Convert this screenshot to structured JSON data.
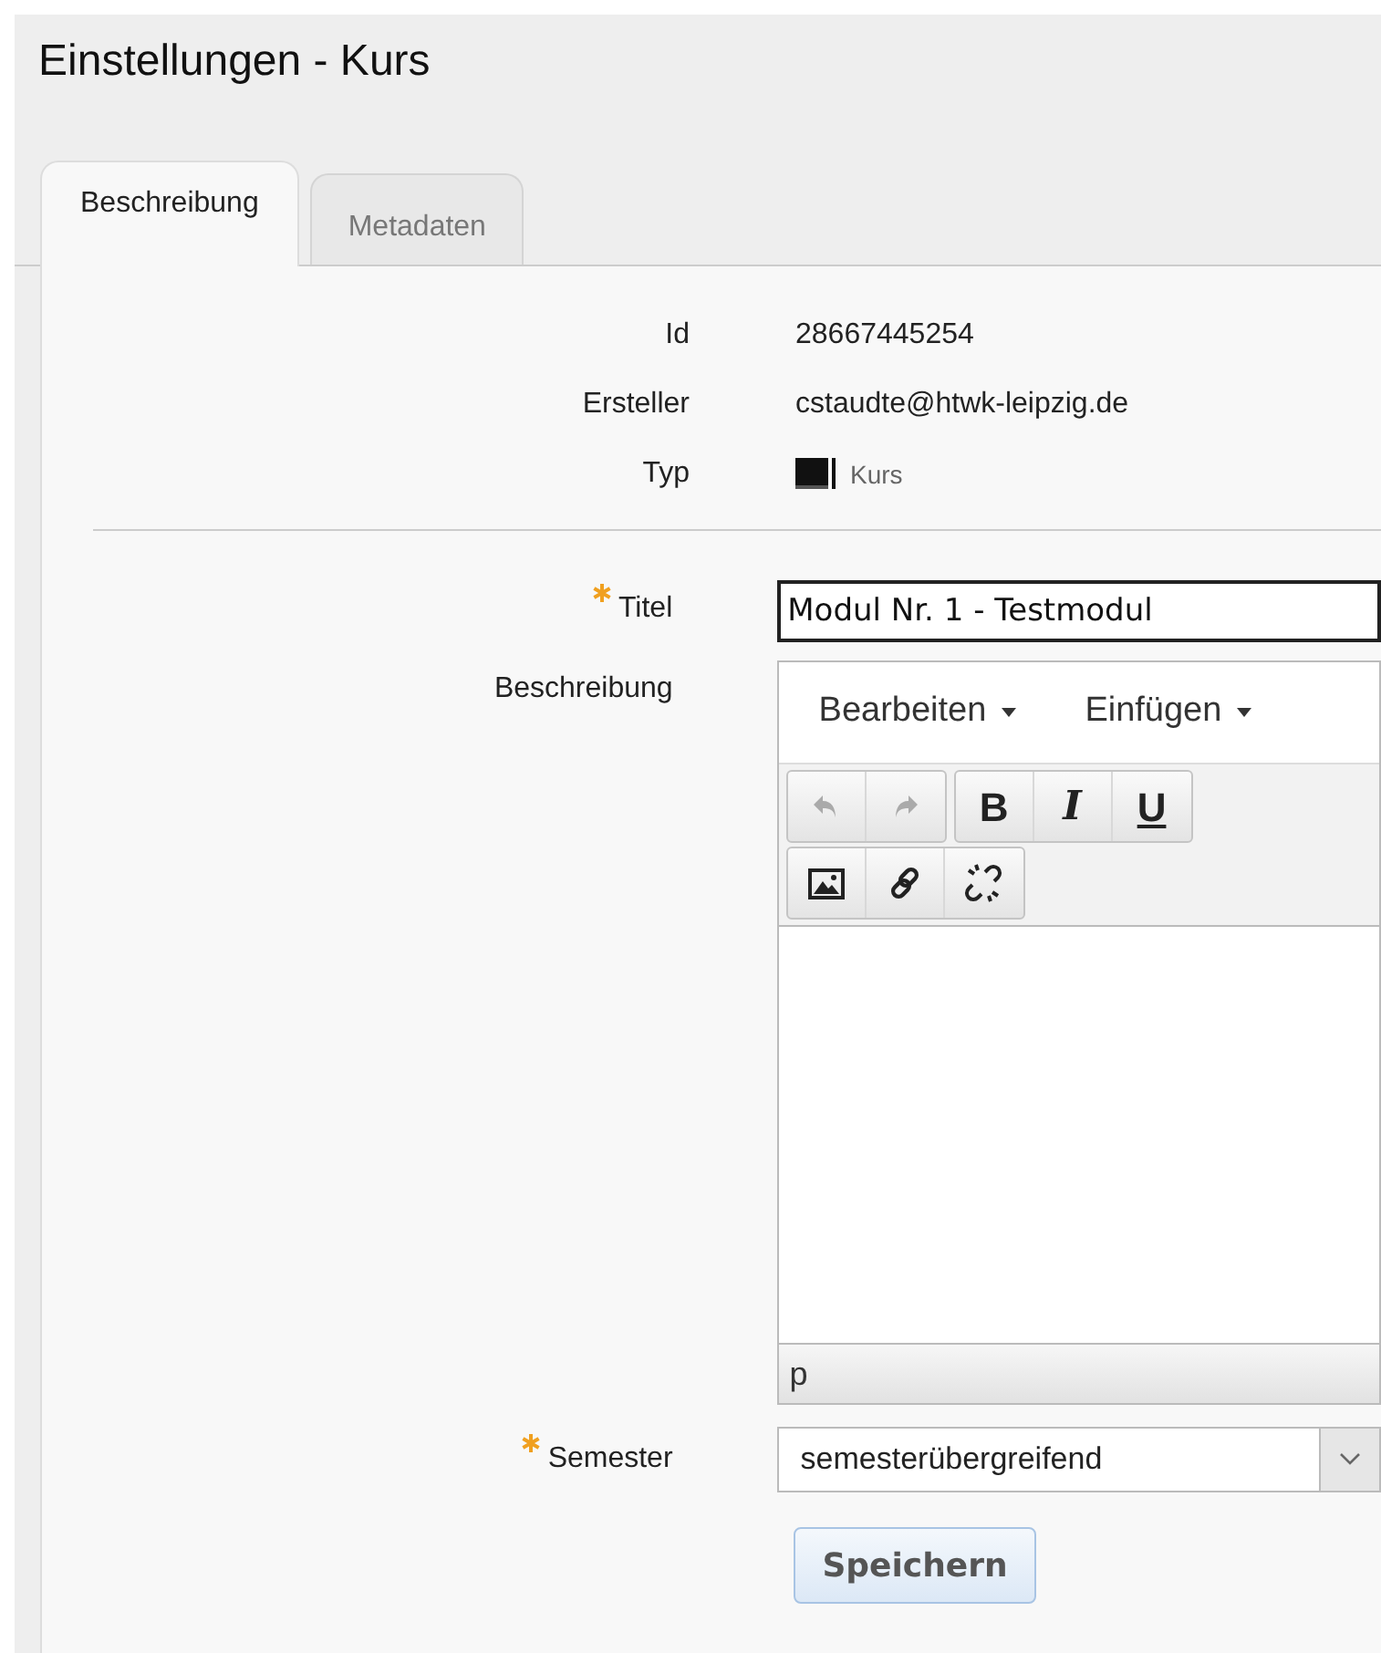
{
  "title": "Einstellungen - Kurs",
  "tabs": [
    {
      "label": "Beschreibung",
      "selected": true
    },
    {
      "label": "Metadaten",
      "selected": false
    }
  ],
  "info": [
    {
      "label": "Id",
      "value": "28667445254"
    },
    {
      "label": "Ersteller",
      "value": "cstaudte@htwk-leipzig.de"
    },
    {
      "label": "Typ",
      "value": "Kurs",
      "kind": "type"
    }
  ],
  "form": {
    "title_field": {
      "label": "Titel",
      "required": true,
      "value": "Modul Nr. 1 - Testmodul"
    },
    "description": {
      "label": "Beschreibung",
      "menus": [
        "Bearbeiten",
        "Einfügen"
      ],
      "toolbar_rows": [
        [
          [
            {
              "kind": "undo",
              "disabled": true
            },
            {
              "kind": "redo",
              "disabled": true
            }
          ],
          [
            {
              "kind": "bold",
              "label": "B",
              "disabled": false
            },
            {
              "kind": "italic",
              "label": "I",
              "disabled": false
            },
            {
              "kind": "underline",
              "label": "U",
              "disabled": false
            }
          ]
        ],
        [
          [
            {
              "kind": "image",
              "disabled": false
            },
            {
              "kind": "link",
              "disabled": false
            },
            {
              "kind": "unlink",
              "disabled": false
            }
          ]
        ]
      ],
      "path": "p"
    },
    "semester": {
      "label": "Semester",
      "required": true,
      "value": "semesterübergreifend"
    },
    "save_button": "Speichern"
  }
}
